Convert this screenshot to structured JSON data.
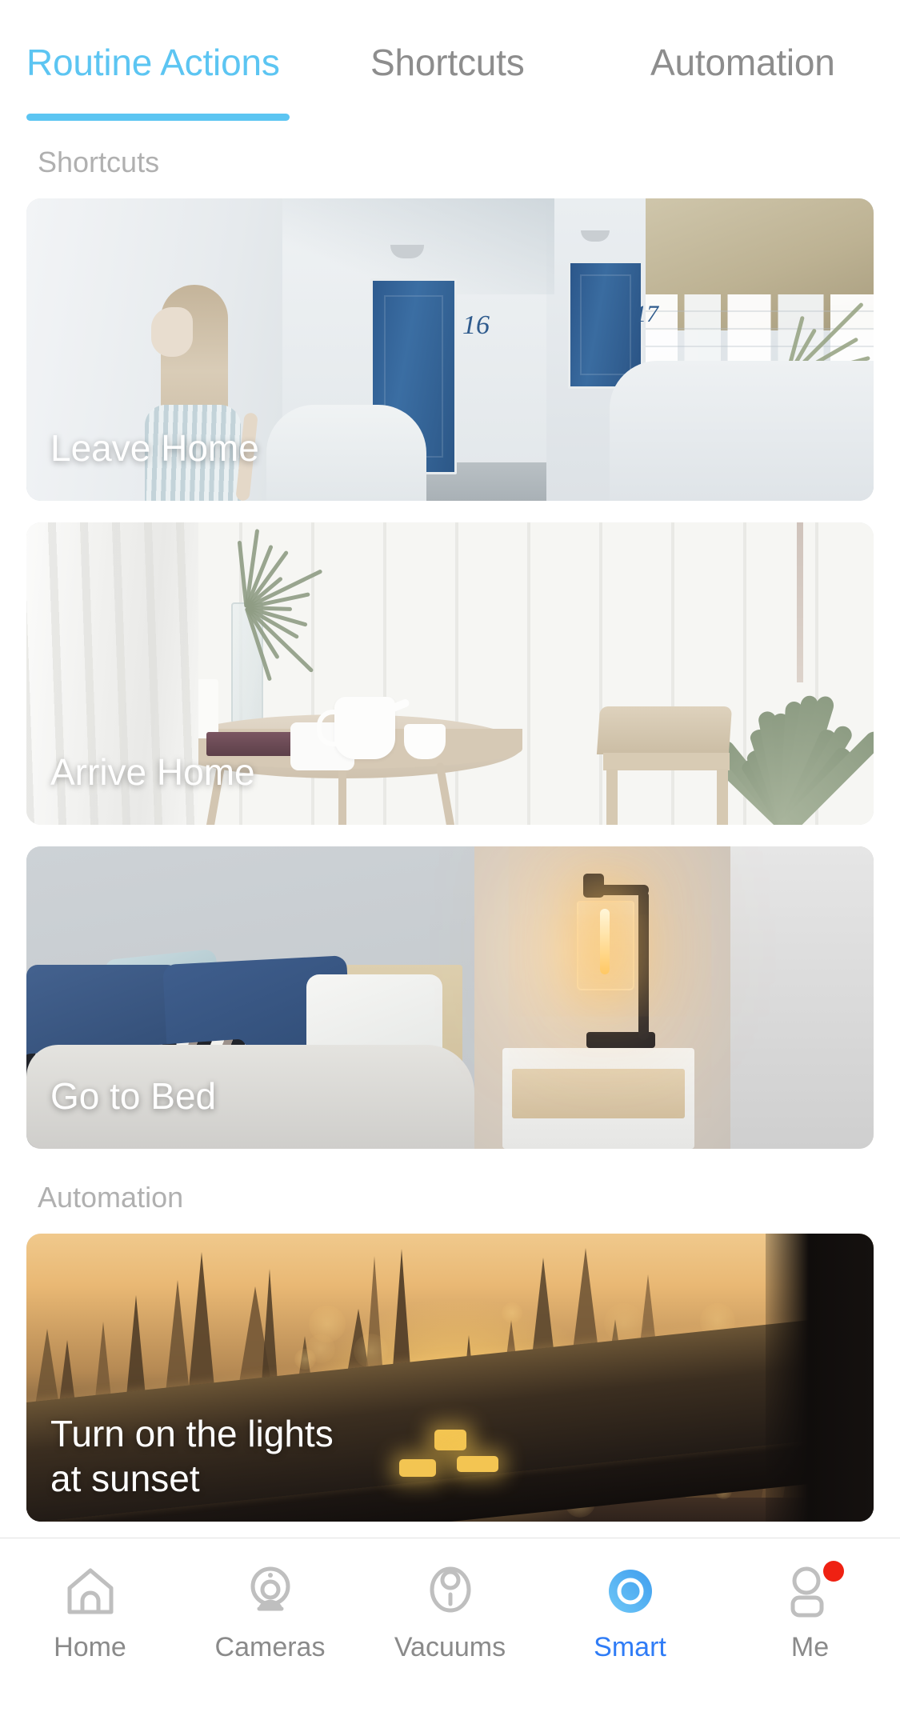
{
  "tabs": [
    {
      "label": "Routine Actions",
      "active": true
    },
    {
      "label": "Shortcuts",
      "active": false
    },
    {
      "label": "Automation",
      "active": false
    }
  ],
  "sections": [
    {
      "title": "Shortcuts"
    },
    {
      "title": "Automation"
    }
  ],
  "cards": [
    {
      "label": "Leave Home",
      "scene": "greek-alley-blue-doors"
    },
    {
      "label": "Arrive Home",
      "scene": "white-room-table-teapot"
    },
    {
      "label": "Go to Bed",
      "scene": "bedroom-lamp-pillows"
    },
    {
      "label": "Turn on the lights\nat sunset",
      "scene": "sunset-forest-window"
    }
  ],
  "bottom_nav": [
    {
      "label": "Home",
      "icon": "house-icon",
      "active": false,
      "badge": false
    },
    {
      "label": "Cameras",
      "icon": "camera-icon",
      "active": false,
      "badge": false
    },
    {
      "label": "Vacuums",
      "icon": "vacuum-icon",
      "active": false,
      "badge": false
    },
    {
      "label": "Smart",
      "icon": "smart-ring-icon",
      "active": true,
      "badge": false
    },
    {
      "label": "Me",
      "icon": "person-icon",
      "active": false,
      "badge": true
    }
  ],
  "colors": {
    "accent_tab": "#5cc5f2",
    "accent_nav_active": "#2f7cf6",
    "inactive_text": "#8a8a8a",
    "section_title": "#b0b0b0",
    "badge_red": "#ef2112",
    "card_label": "#ffffff"
  }
}
